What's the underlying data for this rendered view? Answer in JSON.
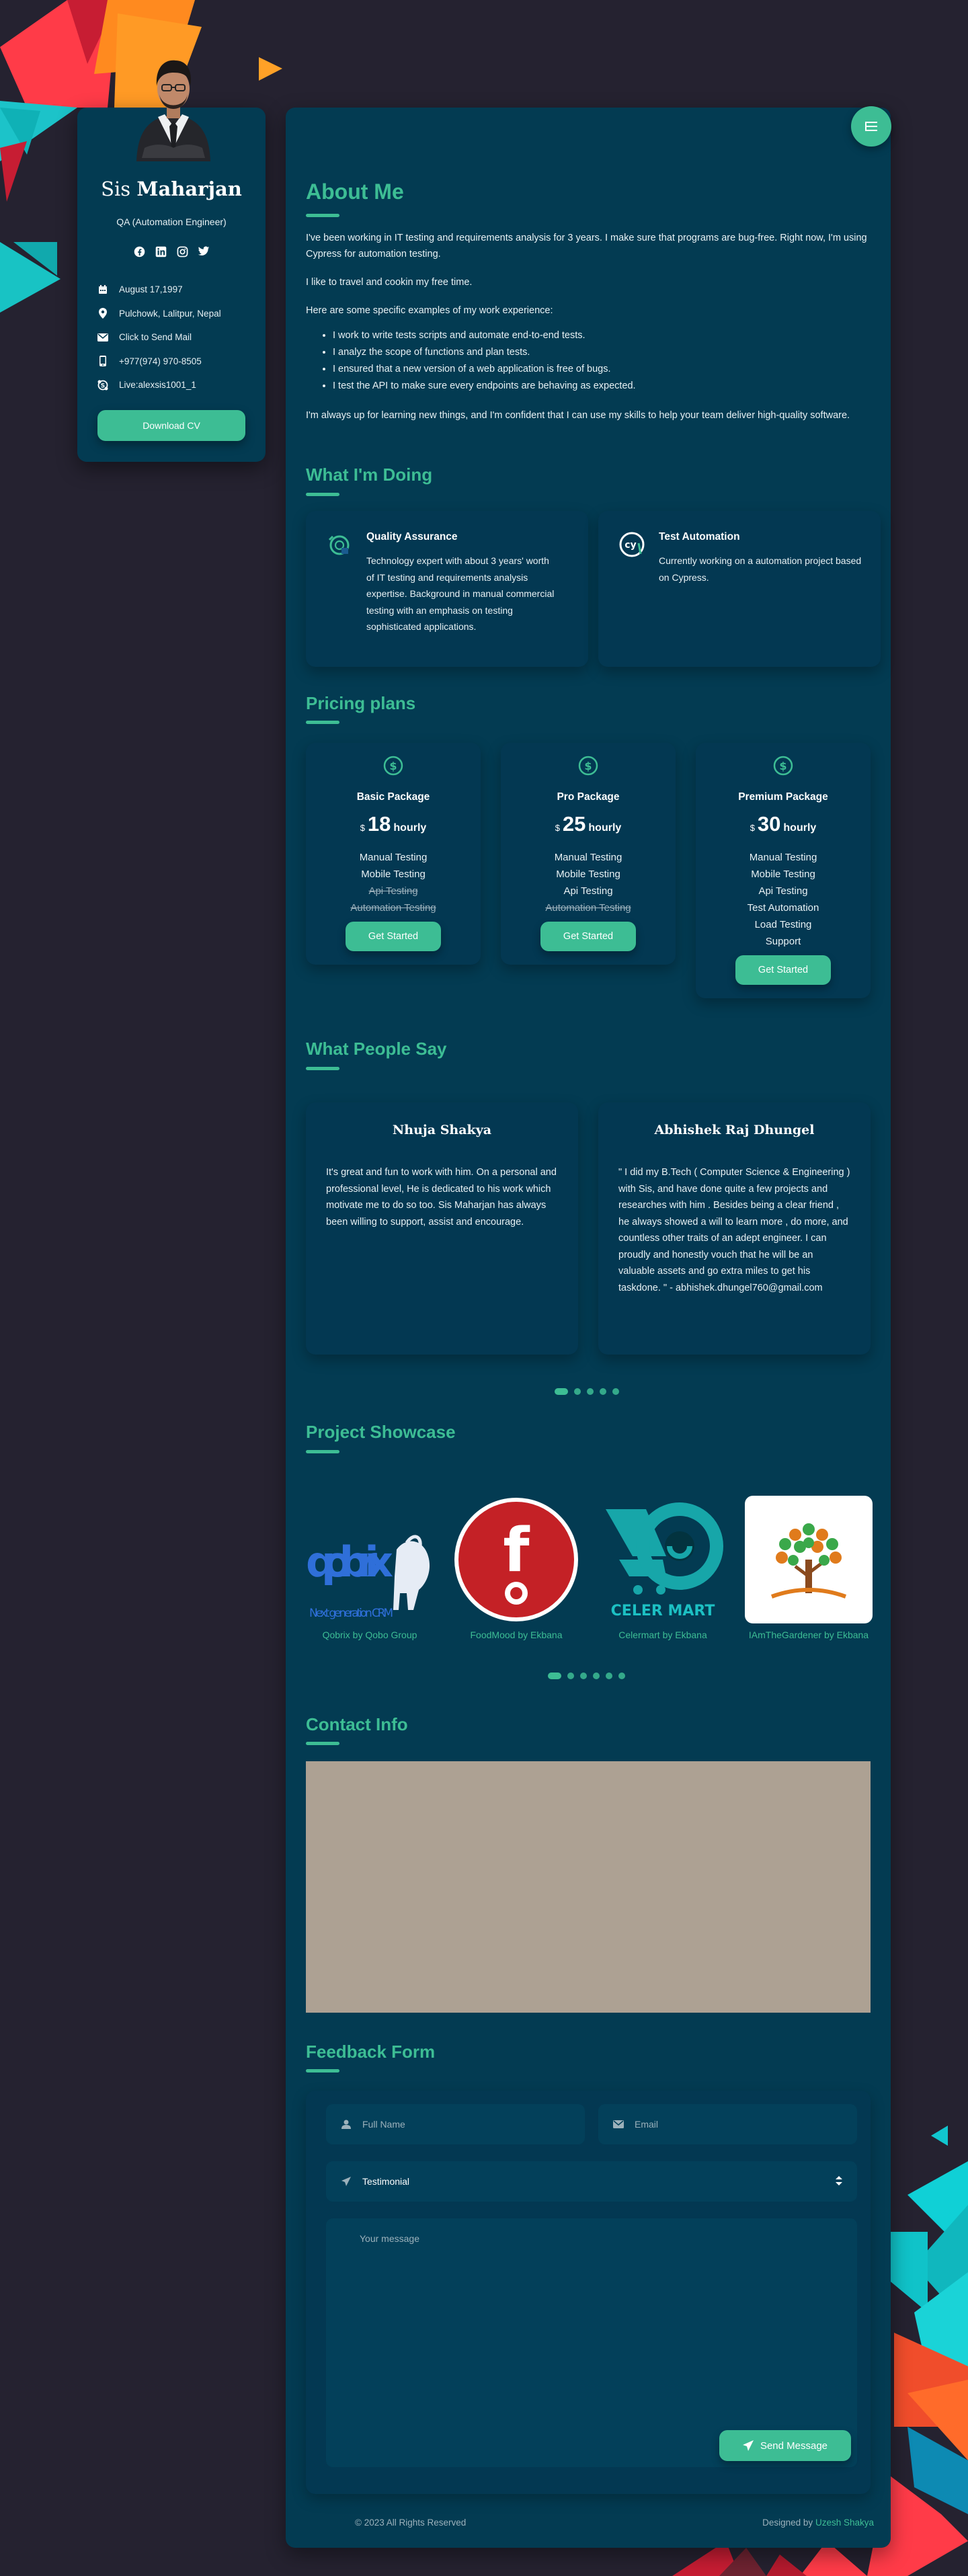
{
  "colors": {
    "background": "#252230",
    "panel": "#033b52",
    "accent": "#3dbd94"
  },
  "sidebar": {
    "first_name": "Sis",
    "last_name": "Maharjan",
    "role": "QA (Automation Engineer)",
    "social": [
      "facebook-icon",
      "linkedin-icon",
      "instagram-icon",
      "twitter-icon"
    ],
    "contacts": [
      {
        "icon": "calendar-icon",
        "text": "August 17,1997"
      },
      {
        "icon": "location-pin-icon",
        "text": "Pulchowk, Lalitpur, Nepal"
      },
      {
        "icon": "mail-icon",
        "text": "Click to Send Mail"
      },
      {
        "icon": "phone-icon",
        "text": "+977(974) 970-8505"
      },
      {
        "icon": "skype-icon",
        "text": "Live:alexsis1001_1"
      }
    ],
    "download_label": "Download CV"
  },
  "about": {
    "title": "About Me",
    "p1": "I've been working in IT testing and requirements analysis for 3 years. I make sure that programs are bug-free. Right now, I'm using Cypress for automation testing.",
    "p2": "I like to travel and cookin my free time.",
    "p3": "Here are some specific examples of my work experience:",
    "bullets": [
      "I work to write tests scripts and automate end-to-end tests.",
      "I analyz the scope of functions and plan tests.",
      "I ensured that a new version of a web application is free of bugs.",
      "I test the API to make sure every endpoints are behaving as expected."
    ],
    "p4": "I'm always up for learning new things, and I'm confident that I can use my skills to help your team deliver high-quality software."
  },
  "doing": {
    "title": "What I'm Doing",
    "items": [
      {
        "icon": "quality-assurance-icon",
        "title": "Quality Assurance",
        "text": "Technology expert with about 3 years' worth of IT testing and requirements analysis expertise. Background in manual commercial testing with an emphasis on testing sophisticated applications."
      },
      {
        "icon": "cypress-icon",
        "title": "Test Automation",
        "text": "Currently working on a automation project based on Cypress."
      }
    ]
  },
  "pricing": {
    "title": "Pricing plans",
    "plans": [
      {
        "name": "Basic Package",
        "currency": "$",
        "amount": "18",
        "per": "hourly",
        "features": [
          {
            "t": "Manual Testing",
            "on": true
          },
          {
            "t": "Mobile Testing",
            "on": true
          },
          {
            "t": "Api Testing",
            "on": false
          },
          {
            "t": "Automation Testing",
            "on": false
          }
        ],
        "button": "Get Started"
      },
      {
        "name": "Pro Package",
        "currency": "$",
        "amount": "25",
        "per": "hourly",
        "features": [
          {
            "t": "Manual Testing",
            "on": true
          },
          {
            "t": "Mobile Testing",
            "on": true
          },
          {
            "t": "Api Testing",
            "on": true
          },
          {
            "t": "Automation Testing",
            "on": false
          }
        ],
        "button": "Get Started"
      },
      {
        "name": "Premium Package",
        "currency": "$",
        "amount": "30",
        "per": "hourly",
        "features": [
          {
            "t": "Manual Testing",
            "on": true
          },
          {
            "t": "Mobile Testing",
            "on": true
          },
          {
            "t": "Api Testing",
            "on": true
          },
          {
            "t": "Test Automation",
            "on": true
          },
          {
            "t": "Load Testing",
            "on": true
          },
          {
            "t": "Support",
            "on": true
          }
        ],
        "button": "Get Started"
      }
    ]
  },
  "testimonials": {
    "title": "What People Say",
    "items": [
      {
        "name": "Nhuja Shakya",
        "text": "It's great and fun to work with him. On a personal and professional level, He is dedicated to his work which motivate me to do so too. Sis Maharjan has always been willing to support, assist and encourage."
      },
      {
        "name": "Abhishek Raj Dhungel",
        "text": "\" I did my B.Tech ( Computer Science & Engineering ) with Sis, and have done quite a few projects and researches with him . Besides being a clear friend , he always showed a will to learn more , do more, and countless other traits of an adept engineer. I can proudly and honestly vouch that he will be an valuable assets and go extra miles to get his taskdone. \" - abhishek.dhungel760@gmail.com"
      }
    ]
  },
  "projects": {
    "title": "Project Showcase",
    "items": [
      {
        "caption": "Qobrix by Qobo Group",
        "logo_text": "qobrix",
        "logo_sub": "Next generation CRM"
      },
      {
        "caption": "FoodMood by Ekbana",
        "logo_text": "f"
      },
      {
        "caption": "Celermart by Ekbana",
        "logo_text": "CELER MART"
      },
      {
        "caption": "IAmTheGardener by Ekbana"
      }
    ]
  },
  "contact": {
    "title": "Contact Info"
  },
  "feedback": {
    "title": "Feedback Form",
    "name_placeholder": "Full Name",
    "email_placeholder": "Email",
    "select_value": "Testimonial",
    "message_placeholder": "Your message",
    "send_label": "Send Message"
  },
  "footer": {
    "copyright": "© 2023 All Rights Reserved",
    "designed_by": "Designed by",
    "designer": "Uzesh Shakya"
  }
}
